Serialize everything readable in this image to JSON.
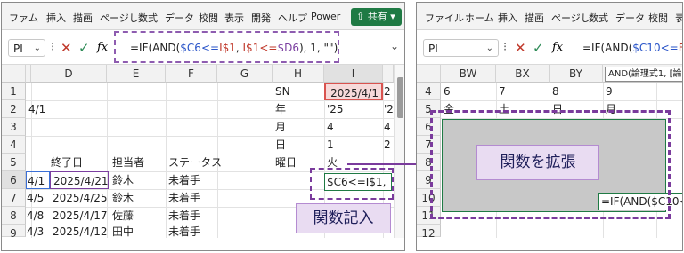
{
  "left_panel": {
    "ribbon_tabs": [
      "ファム",
      "挿入",
      "描画",
      "ページし",
      "数式",
      "データ",
      "校閲",
      "表示",
      "開発",
      "ヘルプ",
      "Power"
    ],
    "share_label": "共有",
    "name_box": "PI",
    "formula": {
      "p1": "=IF(AND(",
      "p2": "$C6<=",
      "p3": "I$1",
      "p4": ", ",
      "p5": "I$1<=",
      "p6": "$D6",
      "p7": "), 1, \"\")"
    },
    "columns": [
      "D",
      "E",
      "F",
      "G",
      "H",
      "I"
    ],
    "rows": [
      "1",
      "2",
      "3",
      "4",
      "5",
      "6",
      "7",
      "8",
      "9"
    ],
    "cells": {
      "c_row2": "4/1",
      "h1": "SN",
      "h2": "年",
      "h3": "月",
      "h4": "日",
      "h5": "曜日",
      "i1": "2025/4/1",
      "i2": "'25",
      "i3": "4",
      "i4": "1",
      "i5": "火",
      "j1": "2",
      "j2": "'2",
      "j3": "4",
      "j4": "2",
      "d5": "終了日",
      "e5": "担当者",
      "f5": "ステータス",
      "c6": "4/1",
      "d6": "2025/4/21",
      "e6": "鈴木",
      "f6": "未着手",
      "c7": "4/5",
      "d7": "2025/4/25",
      "e7": "鈴木",
      "f7": "未着手",
      "c8": "4/8",
      "d8": "2025/4/17",
      "e8": "佐藤",
      "f8": "未着手",
      "c9": "4/3",
      "d9": "2025/4/12",
      "e9": "田中",
      "f9": "未着手",
      "i6": "$C6<=I$1,"
    },
    "callout": "関数記入"
  },
  "right_panel": {
    "ribbon_tabs": [
      "ファイル",
      "ホーム",
      "挿入",
      "描画",
      "ページし",
      "数式",
      "データ",
      "校閲",
      "表"
    ],
    "name_box": "PI",
    "formula": {
      "p1": "=IF(AND(",
      "p2": "$C10<=",
      "p3": "B"
    },
    "tooltip": "AND(論理式1, [論",
    "columns": [
      "BW",
      "BX",
      "BY"
    ],
    "rows": [
      "4",
      "5",
      "6",
      "7",
      "8",
      "9",
      "10",
      "11",
      "12"
    ],
    "cells": {
      "bw4": "6",
      "bx4": "7",
      "by4": "8",
      "bz4": "9",
      "bw5": "金",
      "bx5": "土",
      "by5": "日",
      "bz5": "月",
      "edit": "=IF(AND($C10<"
    },
    "callout": "関数を拡張"
  },
  "colors": {
    "accent_green": "#1f7a44",
    "dash_purple": "#7a3b9c",
    "fill_gray": "#c8c8c8"
  }
}
